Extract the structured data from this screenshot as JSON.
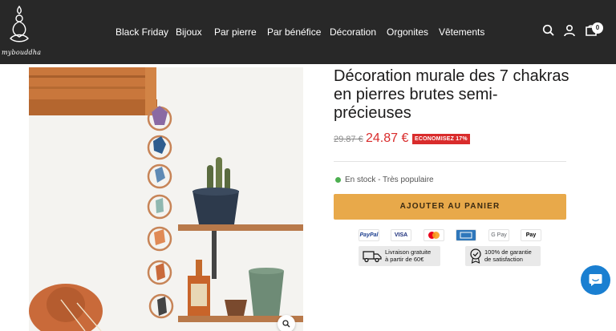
{
  "brand": {
    "logo_text": "mybouddha"
  },
  "nav": {
    "items": [
      "Black Friday",
      "Bijoux",
      "Par pierre",
      "Par bénéfice",
      "Décoration",
      "Orgonites",
      "Vêtements"
    ]
  },
  "header_icons": [
    "search-icon",
    "account-icon",
    "cart-icon"
  ],
  "cart": {
    "count": "0"
  },
  "product": {
    "title": "Décoration murale des 7 chakras en pierres brutes semi-précieuses",
    "old_price": "29.87 €",
    "price": "24.87 €",
    "discount_badge": "ECONOMISEZ 17%",
    "stock": "En stock - Très populaire",
    "add_to_cart": "AJOUTER AU PANIER"
  },
  "payment_methods": [
    "PayPal",
    "VISA",
    "Mastercard",
    "American Express",
    "G Pay",
    "Apple Pay"
  ],
  "payment_labels": {
    "paypal": "PayPal",
    "visa": "VISA",
    "gpay": "G Pay",
    "applepay": "Pay"
  },
  "trust_badges": {
    "shipping": {
      "line1": "Livraison gratuite",
      "line2": "à partir de 60€"
    },
    "guarantee": {
      "line1": "100% de garantie",
      "line2": "de satisfaction"
    }
  },
  "colors": {
    "header_bg": "#282828",
    "price_red": "#d92c2c",
    "cta": "#e8a94a",
    "stock_green": "#4caf50",
    "chat_blue": "#1a7fd1"
  }
}
